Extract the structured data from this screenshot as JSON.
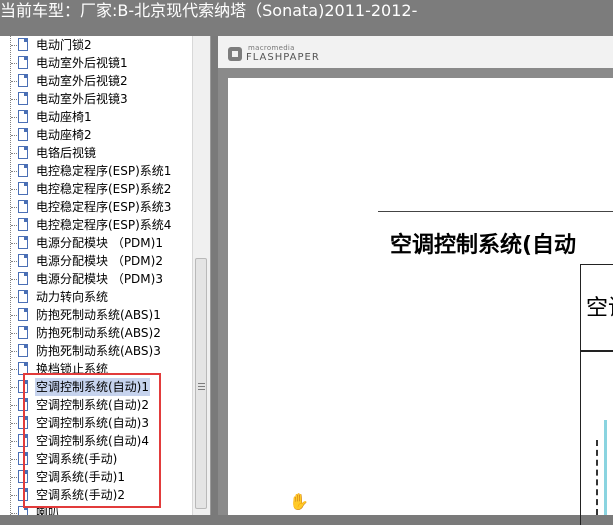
{
  "window": {
    "title": "当前车型：厂家:B-北京现代索纳塔（Sonata)2011-2012-"
  },
  "tree": {
    "items": [
      {
        "label": "电动门锁2"
      },
      {
        "label": "电动室外后视镜1"
      },
      {
        "label": "电动室外后视镜2"
      },
      {
        "label": "电动室外后视镜3"
      },
      {
        "label": "电动座椅1"
      },
      {
        "label": "电动座椅2"
      },
      {
        "label": "电铬后视镜"
      },
      {
        "label": "电控稳定程序(ESP)系统1"
      },
      {
        "label": "电控稳定程序(ESP)系统2"
      },
      {
        "label": "电控稳定程序(ESP)系统3"
      },
      {
        "label": "电控稳定程序(ESP)系统4"
      },
      {
        "label": "电源分配模块 （PDM)1"
      },
      {
        "label": "电源分配模块 （PDM)2"
      },
      {
        "label": "电源分配模块 （PDM)3"
      },
      {
        "label": "动力转向系统"
      },
      {
        "label": "防抱死制动系统(ABS)1"
      },
      {
        "label": "防抱死制动系统(ABS)2"
      },
      {
        "label": "防抱死制动系统(ABS)3"
      },
      {
        "label": "换档锁止系统"
      },
      {
        "label": "空调控制系统(自动)1",
        "selected": true
      },
      {
        "label": "空调控制系统(自动)2"
      },
      {
        "label": "空调控制系统(自动)3"
      },
      {
        "label": "空调控制系统(自动)4"
      },
      {
        "label": "空调系统(手动)"
      },
      {
        "label": "空调系统(手动)1"
      },
      {
        "label": "空调系统(手动)2"
      },
      {
        "label": "喇叭"
      }
    ]
  },
  "viewer": {
    "brand_small": "macromedia",
    "brand_big": "FLASHPAPER",
    "page_title": "空调控制系统(自动",
    "page_box_text": "空调"
  },
  "colors": {
    "highlight_box": "#e23b3b",
    "selection": "#c6d3ee",
    "titlebar": "#7c7c7c"
  },
  "icons": {
    "tree_item": "document-icon",
    "cursor": "hand-cursor-icon",
    "logo": "flashpaper-logo-icon"
  }
}
